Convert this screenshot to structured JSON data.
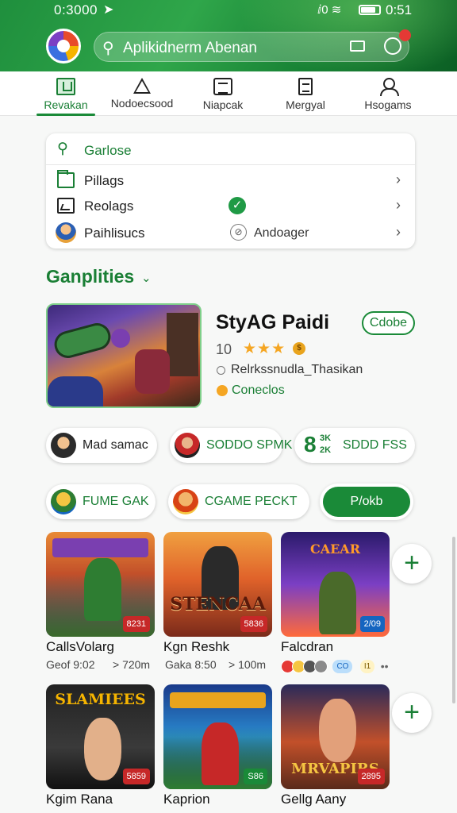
{
  "status_bar": {
    "time": "0:3000",
    "location_icon": "navigation-arrow-icon",
    "signals": "ⅈ0 ≋",
    "clock": "0:51"
  },
  "header": {
    "search_placeholder": "Aplikidnerm Abenan",
    "notification_count": ""
  },
  "tabs": [
    {
      "label": "Revakan",
      "active": true
    },
    {
      "label": "Nodoecsood",
      "active": false
    },
    {
      "label": "Niapcak",
      "active": false
    },
    {
      "label": "Mergyal",
      "active": false
    },
    {
      "label": "Hsogams",
      "active": false
    }
  ],
  "quick_menu": {
    "search_label": "Garlose",
    "items": [
      {
        "label": "Pillags"
      },
      {
        "label": "Reolags"
      },
      {
        "label": "Paihlisucs",
        "sub": "Andoager"
      }
    ]
  },
  "section": {
    "title": "Ganplities"
  },
  "featured": {
    "title": "StyAG Paidi",
    "button": "Cdobe",
    "rating": "10",
    "stars": "★★★",
    "developer": "Relrkssnudla_Thasikan",
    "status": "Coneclos"
  },
  "chips": [
    {
      "label": "Mad samac"
    },
    {
      "label": "SODDO SPMK"
    },
    {
      "big": "8",
      "sup": "3K",
      "sub": "2K",
      "label": "SDDD FSS"
    },
    {
      "label": "FUME GAK"
    },
    {
      "label": "CGAME PECKT"
    },
    {
      "label": "P/okb"
    }
  ],
  "games": [
    {
      "name": "CallsVolarg",
      "meta1": "Geof 9:02",
      "meta2": "> 720m",
      "badge": "8231",
      "banner": ""
    },
    {
      "name": "Kgn Reshk",
      "meta1": "Gaka 8:50",
      "meta2": "> 100m",
      "badge": "5836",
      "banner": "STENCAA"
    },
    {
      "name": "Falcdran",
      "badge": "2/09",
      "banner": "CAEAR",
      "tags": [
        "CO",
        "I1"
      ]
    },
    {
      "name": "Kgim Rana",
      "badge": "5859",
      "banner": "SLAMIEES"
    },
    {
      "name": "Kaprion",
      "badge": "S86",
      "banner": ""
    },
    {
      "name": "Gellg Aany",
      "badge": "2895",
      "banner": "MRVAPIRS"
    }
  ],
  "colors": {
    "brand_green": "#1a7f35",
    "header_green": "#2fa64a",
    "accent_orange": "#f5a623"
  }
}
